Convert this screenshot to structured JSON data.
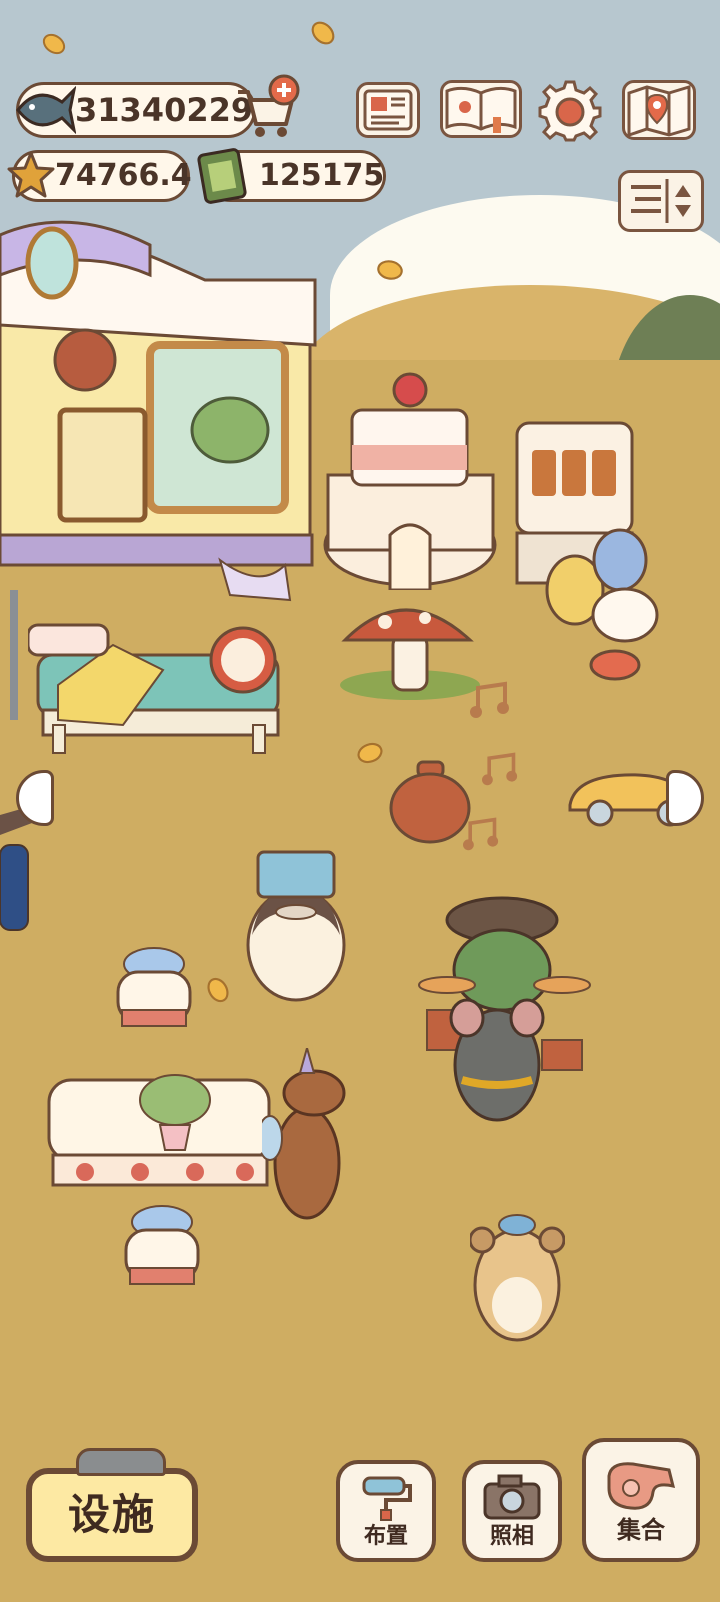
{
  "currency": {
    "fish": "31340229",
    "star": "74766.4",
    "ticket": "125175"
  },
  "icons": {
    "fish": "fish-icon",
    "cart": "shopping-cart-icon",
    "star": "star-icon",
    "ticket": "film-ticket-icon",
    "news": "newspaper-icon",
    "book": "album-book-icon",
    "settings": "gear-icon",
    "map": "map-icon",
    "sort": "sort-toggle-icon"
  },
  "bottom": {
    "facility_label": "设施",
    "layout_label": "布置",
    "photo_label": "照相",
    "gather_label": "集合"
  },
  "colors": {
    "sky": "#b7c7cf",
    "ground": "#cfad62",
    "outline": "#6b4a35",
    "facility_button": "#fde9a3"
  }
}
